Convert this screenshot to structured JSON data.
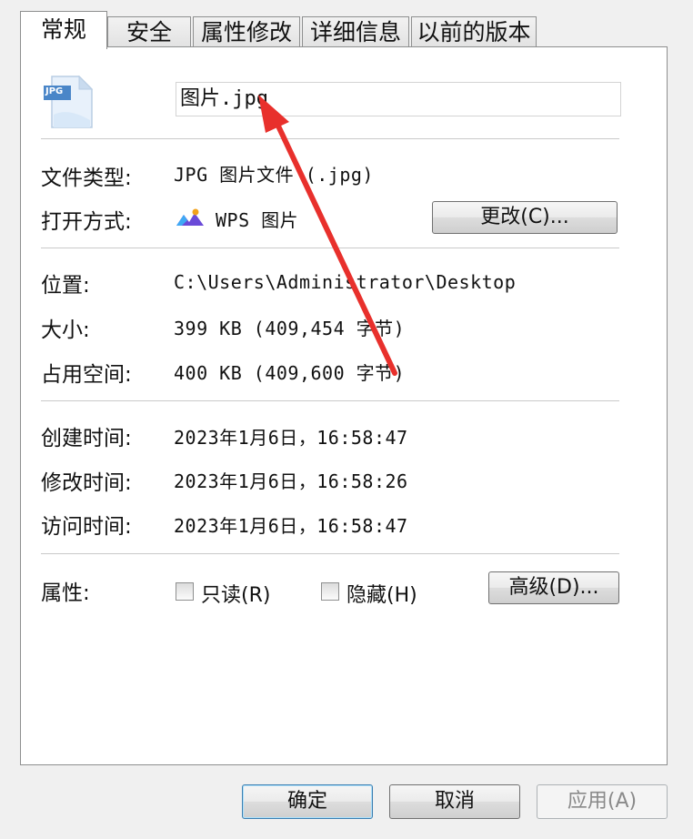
{
  "tabs": [
    "常规",
    "安全",
    "属性修改",
    "详细信息",
    "以前的版本"
  ],
  "file": {
    "icon_badge": "JPG",
    "name": "图片.jpg"
  },
  "info": {
    "type_label": "文件类型:",
    "type_value": "JPG 图片文件 (.jpg)",
    "open_label": "打开方式:",
    "open_app": "WPS 图片",
    "change_button": "更改(C)...",
    "location_label": "位置:",
    "location_value": "C:\\Users\\Administrator\\Desktop",
    "size_label": "大小:",
    "size_value": "399 KB (409,454 字节)",
    "disk_label": "占用空间:",
    "disk_value": "400 KB (409,600 字节)",
    "created_label": "创建时间:",
    "created_value": "2023年1月6日，16:58:47",
    "modified_label": "修改时间:",
    "modified_value": "2023年1月6日，16:58:26",
    "accessed_label": "访问时间:",
    "accessed_value": "2023年1月6日，16:58:47",
    "attr_label": "属性:",
    "readonly_label": "只读(R)",
    "readonly_checked": false,
    "hidden_label": "隐藏(H)",
    "hidden_checked": false,
    "advanced_button": "高级(D)..."
  },
  "footer": {
    "ok": "确定",
    "cancel": "取消",
    "apply": "应用(A)"
  },
  "colors": {
    "annotation_arrow": "#e8302c",
    "panel_bg": "#ffffff",
    "window_bg": "#f0f0f0"
  }
}
